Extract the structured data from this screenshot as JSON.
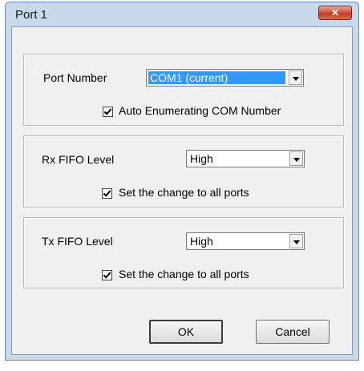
{
  "window": {
    "title": "Port 1",
    "close_glyph": "✕"
  },
  "port_group": {
    "label": "Port Number",
    "value": "COM1 (current)",
    "auto_enum_label": "Auto Enumerating COM Number",
    "auto_enum_checked": true
  },
  "rx_group": {
    "label": "Rx FIFO Level",
    "value": "High",
    "apply_all_label": "Set the change to all ports",
    "apply_all_checked": true
  },
  "tx_group": {
    "label": "Tx FIFO Level",
    "value": "High",
    "apply_all_label": "Set the change to all ports",
    "apply_all_checked": true
  },
  "buttons": {
    "ok": "OK",
    "cancel": "Cancel"
  }
}
